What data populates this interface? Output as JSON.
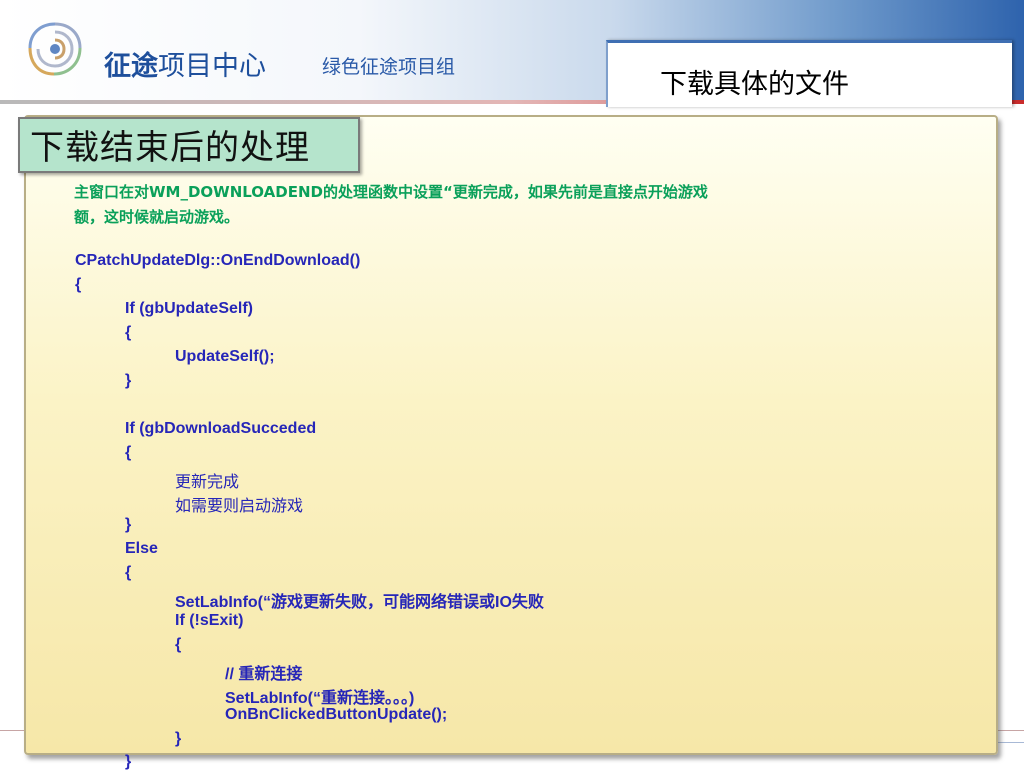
{
  "header": {
    "brand_bold": "征途",
    "brand_rest": "项目中心",
    "group": "绿色征途项目组",
    "title": "下载具体的文件"
  },
  "panel": {
    "tag": "下载结束后的处理",
    "intro_line1": "主窗口在对WM_DOWNLOADEND的处理函数中设置“更新完成，如果先前是直接点开始游戏",
    "intro_line2": "额，这时候就启动游戏。"
  },
  "code": {
    "l1": "CPatchUpdateDlg::OnEndDownload()",
    "l2": "{",
    "l3": "If (gbUpdateSelf)",
    "l4": "{",
    "l5": "UpdateSelf();",
    "l6": "}",
    "l7": "If (gbDownloadSucceded",
    "l8": "{",
    "l9": "更新完成",
    "l10": "如需要则启动游戏",
    "l11": "}",
    "l12": "Else",
    "l13": "{",
    "l14": "SetLabInfo(“游戏更新失败，可能网络错误或IO失败",
    "l15": "If (!sExit)",
    "l16": "{",
    "l17": "// 重新连接",
    "l18": "SetLabInfo(“重新连接。。。)",
    "l19": "OnBnClickedButtonUpdate();",
    "l20": "}",
    "l21": "}"
  },
  "colors": {
    "brand": "#1e4f9c",
    "code": "#2626b8",
    "intro": "#0aa05a",
    "panel": "#f6e7a8",
    "tag": "#b5e4cc"
  },
  "icons": {
    "logo": "zhengtu-logo-icon"
  }
}
